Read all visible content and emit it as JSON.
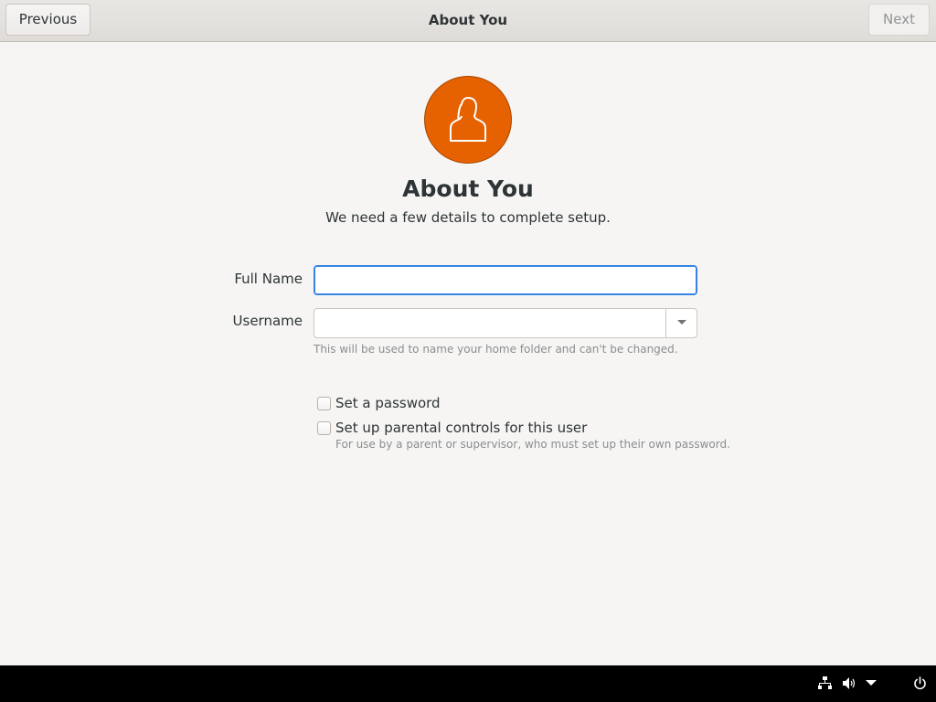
{
  "headerbar": {
    "previous_label": "Previous",
    "title": "About You",
    "next_label": "Next"
  },
  "main": {
    "avatar_icon": "user-avatar-icon",
    "title": "About You",
    "subtitle": "We need a few details to complete setup."
  },
  "form": {
    "full_name_label": "Full Name",
    "full_name_value": "",
    "username_label": "Username",
    "username_value": "",
    "username_hint": "This will be used to name your home folder and can't be changed."
  },
  "options": {
    "set_password_label": "Set a password",
    "set_password_checked": false,
    "parental_controls_label": "Set up parental controls for this user",
    "parental_controls_checked": false,
    "parental_controls_hint": "For use by a parent or supervisor, who must set up their own password."
  },
  "top_panel": {
    "icons": [
      "network-icon",
      "volume-icon",
      "menu-arrow-icon",
      "power-icon"
    ]
  },
  "colors": {
    "accent": "#3584e4",
    "avatar_bg": "#e66100",
    "panel_bg": "#000000",
    "window_bg": "#f6f5f4"
  }
}
